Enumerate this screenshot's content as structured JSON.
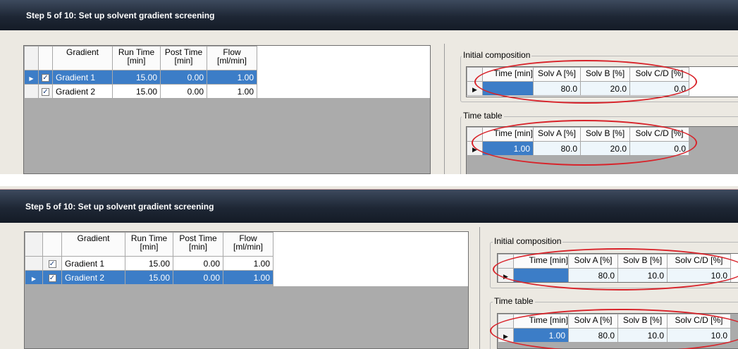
{
  "panels": [
    {
      "title": "Step 5 of 10:  Set up solvent gradient screening",
      "gradient_table": {
        "headers": [
          "Gradient",
          "Run Time\n[min]",
          "Post Time\n[min]",
          "Flow\n[ml/min]"
        ],
        "rows": [
          {
            "name": "Gradient 1",
            "run_time": "15.00",
            "post_time": "0.00",
            "flow": "1.00",
            "checked": true,
            "selected": true
          },
          {
            "name": "Gradient 2",
            "run_time": "15.00",
            "post_time": "0.00",
            "flow": "1.00",
            "checked": true,
            "selected": false
          }
        ]
      },
      "initial_composition": {
        "label": "Initial composition",
        "headers": [
          "Time [min]",
          "Solv A [%]",
          "Solv B [%]",
          "Solv C/D [%]"
        ],
        "row": {
          "time": "",
          "solv_a": "80.0",
          "solv_b": "20.0",
          "solv_cd": "0.0"
        }
      },
      "time_table": {
        "label": "Time table",
        "headers": [
          "Time [min]",
          "Solv A [%]",
          "Solv B [%]",
          "Solv C/D [%]"
        ],
        "row": {
          "time": "1.00",
          "solv_a": "80.0",
          "solv_b": "20.0",
          "solv_cd": "0.0"
        }
      }
    },
    {
      "title": "Step 5 of 10:  Set up solvent gradient screening",
      "gradient_table": {
        "headers": [
          "Gradient",
          "Run Time\n[min]",
          "Post Time\n[min]",
          "Flow\n[ml/min]"
        ],
        "rows": [
          {
            "name": "Gradient 1",
            "run_time": "15.00",
            "post_time": "0.00",
            "flow": "1.00",
            "checked": true,
            "selected": false
          },
          {
            "name": "Gradient 2",
            "run_time": "15.00",
            "post_time": "0.00",
            "flow": "1.00",
            "checked": true,
            "selected": true
          }
        ]
      },
      "initial_composition": {
        "label": "Initial composition",
        "headers": [
          "Time [min]",
          "Solv A [%]",
          "Solv B [%]",
          "Solv C/D [%]"
        ],
        "row": {
          "time": "",
          "solv_a": "80.0",
          "solv_b": "10.0",
          "solv_cd": "10.0"
        }
      },
      "time_table": {
        "label": "Time table",
        "headers": [
          "Time [min]",
          "Solv A [%]",
          "Solv B [%]",
          "Solv C/D [%]"
        ],
        "row": {
          "time": "1.00",
          "solv_a": "80.0",
          "solv_b": "10.0",
          "solv_cd": "10.0"
        }
      }
    }
  ],
  "colors": {
    "selection": "#3c7dc7",
    "annotation": "#d8232a",
    "title_bar": "#1e2735"
  },
  "icons": [
    "row-selector-arrow-icon",
    "checkbox-checked-icon"
  ]
}
